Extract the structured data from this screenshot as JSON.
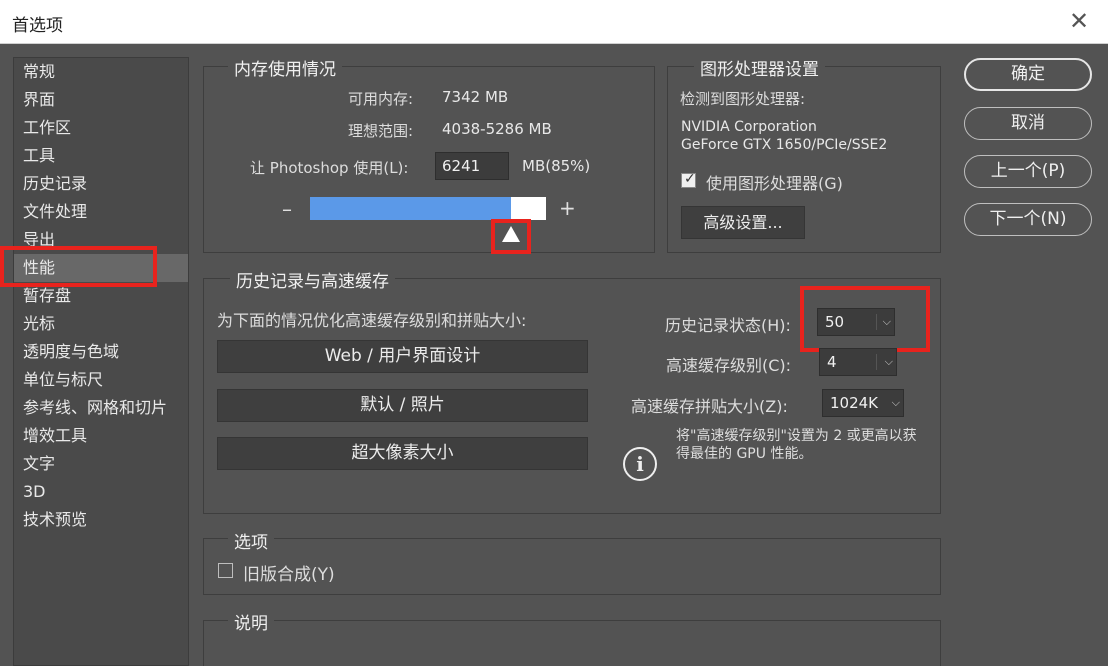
{
  "window": {
    "title": "首选项",
    "close_glyph": "✕"
  },
  "sidebar": {
    "items": [
      {
        "label": "常规"
      },
      {
        "label": "界面"
      },
      {
        "label": "工作区"
      },
      {
        "label": "工具"
      },
      {
        "label": "历史记录"
      },
      {
        "label": "文件处理"
      },
      {
        "label": "导出"
      },
      {
        "label": "性能"
      },
      {
        "label": "暂存盘"
      },
      {
        "label": "光标"
      },
      {
        "label": "透明度与色域"
      },
      {
        "label": "单位与标尺"
      },
      {
        "label": "参考线、网格和切片"
      },
      {
        "label": "增效工具"
      },
      {
        "label": "文字"
      },
      {
        "label": "3D"
      },
      {
        "label": "技术预览"
      }
    ],
    "active_index": 7
  },
  "memory": {
    "title": "内存使用情况",
    "available_label": "可用内存:",
    "available_value": "7342 MB",
    "ideal_label": "理想范围:",
    "ideal_value": "4038-5286 MB",
    "let_label": "让 Photoshop 使用(L):",
    "let_value": "6241",
    "let_unit": "MB(85%)",
    "minus": "–",
    "plus": "+",
    "slider_percent": 85
  },
  "gpu": {
    "title": "图形处理器设置",
    "detected_label": "检测到图形处理器:",
    "vendor": "NVIDIA Corporation",
    "model": "GeForce GTX 1650/PCIe/SSE2",
    "use_gpu_label": "使用图形处理器(G)",
    "use_gpu_checked": true,
    "advanced_button": "高级设置..."
  },
  "actions": {
    "ok": "确定",
    "cancel": "取消",
    "prev": "上一个(P)",
    "next": "下一个(N)"
  },
  "history_cache": {
    "title": "历史记录与高速缓存",
    "optimize_label": "为下面的情况优化高速缓存级别和拼贴大小:",
    "presets": [
      "Web / 用户界面设计",
      "默认 / 照片",
      "超大像素大小"
    ],
    "history_states_label": "历史记录状态(H):",
    "history_states_value": "50",
    "cache_levels_label": "高速缓存级别(C):",
    "cache_levels_value": "4",
    "tile_size_label": "高速缓存拼贴大小(Z):",
    "tile_size_value": "1024K",
    "note": "将\"高速缓存级别\"设置为 2 或更高以获得最佳的 GPU 性能。",
    "info_icon": "i"
  },
  "options": {
    "title": "选项",
    "legacy_label": "旧版合成(Y)",
    "legacy_checked": false
  },
  "description": {
    "title": "说明"
  },
  "colors": {
    "highlight": "#e8231d",
    "slider_fill": "#5b99e8"
  }
}
